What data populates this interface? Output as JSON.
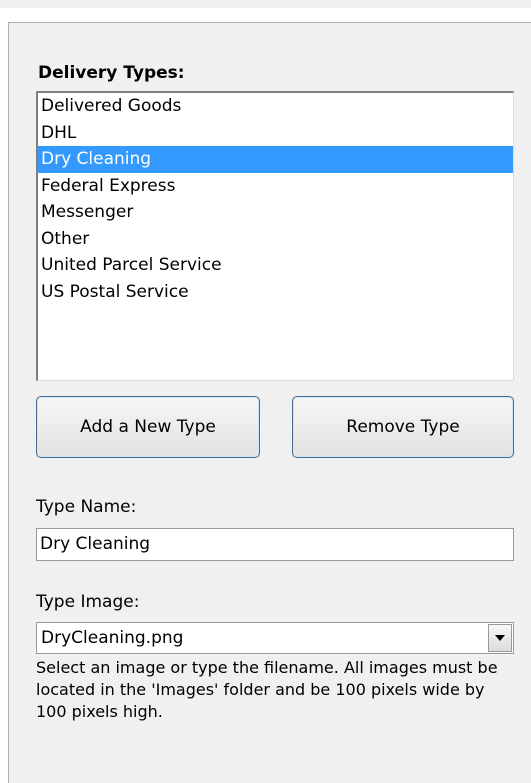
{
  "delivery_types": {
    "heading": "Delivery Types:",
    "items": [
      {
        "label": "Delivered Goods",
        "selected": false
      },
      {
        "label": "DHL",
        "selected": false
      },
      {
        "label": "Dry Cleaning",
        "selected": true
      },
      {
        "label": "Federal Express",
        "selected": false
      },
      {
        "label": "Messenger",
        "selected": false
      },
      {
        "label": "Other",
        "selected": false
      },
      {
        "label": "United Parcel Service",
        "selected": false
      },
      {
        "label": "US Postal Service",
        "selected": false
      }
    ]
  },
  "buttons": {
    "add_label": "Add a New Type",
    "remove_label": "Remove Type"
  },
  "type_name": {
    "label": "Type Name:",
    "value": "Dry Cleaning"
  },
  "type_image": {
    "label": "Type Image:",
    "value": "DryCleaning.png",
    "dropdown_icon": "chevron-down-icon",
    "help": "Select an image or type the filename. All images must be located in the 'Images' folder and be 100 pixels wide by 100 pixels high."
  },
  "colors": {
    "selection": "#3399ff",
    "panel": "#f0f0f0"
  }
}
